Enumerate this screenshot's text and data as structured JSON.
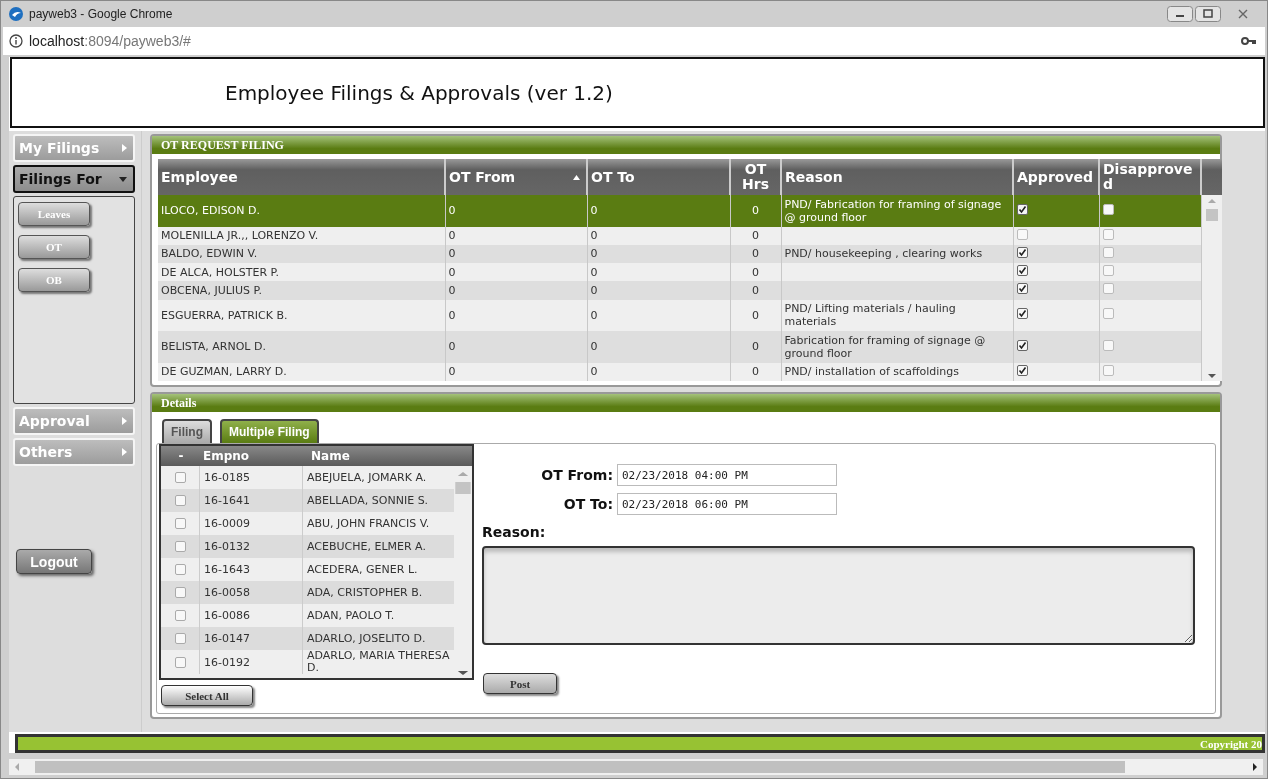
{
  "window": {
    "title": "payweb3 - Google Chrome"
  },
  "address": {
    "host": "localhost",
    "path": ":8094/payweb3/#"
  },
  "page": {
    "title": "Employee Filings & Approvals (ver 1.2)"
  },
  "sidebar": {
    "menus": [
      {
        "label": "My Filings",
        "expanded": false
      },
      {
        "label": "Filings For",
        "expanded": true,
        "children": [
          {
            "label": "Leaves"
          },
          {
            "label": "OT"
          },
          {
            "label": "OB"
          }
        ]
      },
      {
        "label": "Approval",
        "expanded": false
      },
      {
        "label": "Others",
        "expanded": false
      }
    ],
    "logout": "Logout"
  },
  "ot_panel": {
    "title": "OT REQUEST FILING",
    "columns": [
      {
        "label": "Employee",
        "sorted": false
      },
      {
        "label": "OT From",
        "sorted": true
      },
      {
        "label": "OT To",
        "sorted": false
      },
      {
        "label": "OT Hrs",
        "sorted": false
      },
      {
        "label": "Reason",
        "sorted": false
      },
      {
        "label": "Approved",
        "sorted": false
      },
      {
        "label": "Disapproved",
        "sorted": false
      }
    ],
    "rows": [
      {
        "employee": "ILOCO, EDISON D.",
        "ot_from": "0",
        "ot_to": "0",
        "ot_hrs": "0",
        "reason": "PND/ Fabrication for framing of signage @ ground floor",
        "approved": true,
        "disapproved": false,
        "selected": true
      },
      {
        "employee": "MOLENILLA JR.,, LORENZO V.",
        "ot_from": "0",
        "ot_to": "0",
        "ot_hrs": "0",
        "reason": "",
        "approved": false,
        "disapproved": false,
        "selected": false
      },
      {
        "employee": "BALDO, EDWIN V.",
        "ot_from": "0",
        "ot_to": "0",
        "ot_hrs": "0",
        "reason": "PND/ housekeeping , clearing works",
        "approved": true,
        "disapproved": false,
        "selected": false
      },
      {
        "employee": "DE ALCA, HOLSTER P.",
        "ot_from": "0",
        "ot_to": "0",
        "ot_hrs": "0",
        "reason": "",
        "approved": true,
        "disapproved": false,
        "selected": false
      },
      {
        "employee": "OBCENA, JULIUS P.",
        "ot_from": "0",
        "ot_to": "0",
        "ot_hrs": "0",
        "reason": "",
        "approved": true,
        "disapproved": false,
        "selected": false
      },
      {
        "employee": "ESGUERRA, PATRICK B.",
        "ot_from": "0",
        "ot_to": "0",
        "ot_hrs": "0",
        "reason": "PND/ Lifting materials / hauling materials",
        "approved": true,
        "disapproved": false,
        "selected": false
      },
      {
        "employee": "BELISTA, ARNOL D.",
        "ot_from": "0",
        "ot_to": "0",
        "ot_hrs": "0",
        "reason": "Fabrication for framing of signage @ ground floor",
        "approved": true,
        "disapproved": false,
        "selected": false
      },
      {
        "employee": "DE GUZMAN, LARRY D.",
        "ot_from": "0",
        "ot_to": "0",
        "ot_hrs": "0",
        "reason": "PND/ installation of scaffoldings",
        "approved": true,
        "disapproved": false,
        "selected": false
      }
    ]
  },
  "details": {
    "title": "Details",
    "tabs": [
      {
        "label": "Filing",
        "selected": false
      },
      {
        "label": "Multiple Filing",
        "selected": true
      }
    ],
    "list_columns": [
      "-",
      "Empno",
      "Name"
    ],
    "list_rows": [
      {
        "empno": "16-0185",
        "name": "ABEJUELA, JOMARK A.",
        "checked": false
      },
      {
        "empno": "16-1641",
        "name": "ABELLADA, SONNIE S.",
        "checked": false
      },
      {
        "empno": "16-0009",
        "name": "ABU, JOHN FRANCIS V.",
        "checked": false
      },
      {
        "empno": "16-0132",
        "name": "ACEBUCHE, ELMER A.",
        "checked": false
      },
      {
        "empno": "16-1643",
        "name": "ACEDERA, GENER L.",
        "checked": false
      },
      {
        "empno": "16-0058",
        "name": "ADA, CRISTOPHER B.",
        "checked": false
      },
      {
        "empno": "16-0086",
        "name": "ADAN, PAOLO T.",
        "checked": false
      },
      {
        "empno": "16-0147",
        "name": "ADARLO, JOSELITO D.",
        "checked": false
      },
      {
        "empno": "16-0192",
        "name": "ADARLO, MARIA THERESA D.",
        "checked": false
      }
    ],
    "select_all": "Select All",
    "ot_from": {
      "label": "OT From:",
      "value": "02/23/2018 04:00 PM"
    },
    "ot_to": {
      "label": "OT To:",
      "value": "02/23/2018 06:00 PM"
    },
    "reason_label": "Reason:",
    "post": "Post"
  },
  "footer": {
    "copyright": "Copyright 20"
  }
}
